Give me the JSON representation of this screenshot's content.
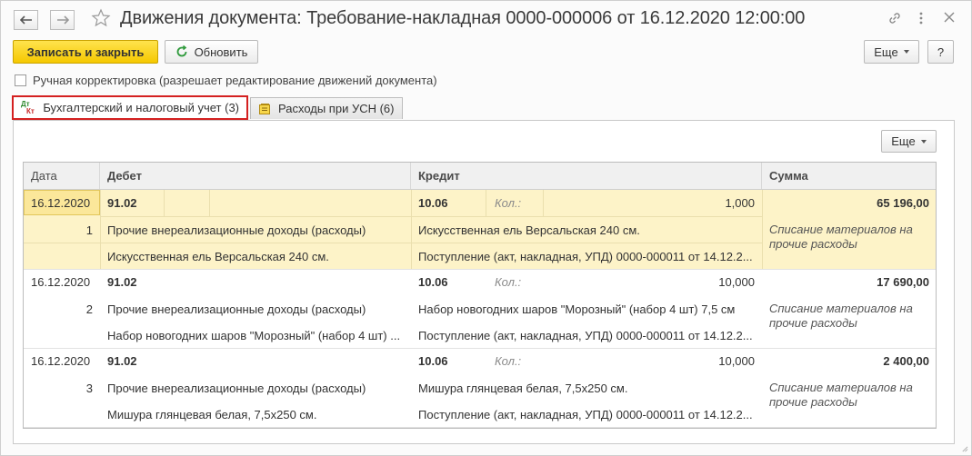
{
  "window": {
    "title": "Движения документа: Требование-накладная 0000-000006 от 16.12.2020 12:00:00",
    "back_icon": "arrow-left-icon",
    "forward_icon": "arrow-right-icon",
    "favorite_icon": "star-icon",
    "link_icon": "link-icon",
    "menu_icon": "more-vertical-icon",
    "close_icon": "close-icon"
  },
  "toolbar": {
    "save_close_label": "Записать и закрыть",
    "refresh_label": "Обновить",
    "more_label": "Еще",
    "help_label": "?"
  },
  "manual_edit": {
    "label": "Ручная корректировка (разрешает редактирование движений документа)",
    "checked": false
  },
  "tabs": [
    {
      "label": "Бухгалтерский и налоговый учет (3)",
      "icon": "dt-kt-icon",
      "icon_top": "Дт",
      "icon_bottom": "Кт",
      "active": true
    },
    {
      "label": "Расходы при УСН (6)",
      "icon": "register-icon",
      "active": false
    }
  ],
  "panel": {
    "more_label": "Еще"
  },
  "table": {
    "columns": [
      "Дата",
      "Дебет",
      "Кредит",
      "Сумма"
    ],
    "rows": [
      {
        "date": "16.12.2020",
        "number": "1",
        "debit_account": "91.02",
        "debit_sub1": "Прочие внереализационные доходы (расходы)",
        "debit_sub2": "Искусственная ель Версальская 240 см.",
        "credit_account": "10.06",
        "qty_label": "Кол.:",
        "qty": "1,000",
        "credit_sub1": "Искусственная ель Версальская 240 см.",
        "credit_sub2": "Поступление (акт, накладная, УПД) 0000-000011 от 14.12.2...",
        "amount": "65 196,00",
        "content": "Списание материалов на прочие расходы",
        "selected": true
      },
      {
        "date": "16.12.2020",
        "number": "2",
        "debit_account": "91.02",
        "debit_sub1": "Прочие внереализационные доходы (расходы)",
        "debit_sub2": "Набор новогодних шаров \"Морозный\" (набор 4 шт) ...",
        "credit_account": "10.06",
        "qty_label": "Кол.:",
        "qty": "10,000",
        "credit_sub1": "Набор новогодних шаров \"Морозный\" (набор 4 шт) 7,5 см",
        "credit_sub2": "Поступление (акт, накладная, УПД) 0000-000011 от 14.12.2...",
        "amount": "17 690,00",
        "content": "Списание материалов на прочие расходы",
        "selected": false
      },
      {
        "date": "16.12.2020",
        "number": "3",
        "debit_account": "91.02",
        "debit_sub1": "Прочие внереализационные доходы (расходы)",
        "debit_sub2": "Мишура глянцевая белая, 7,5х250 см.",
        "credit_account": "10.06",
        "qty_label": "Кол.:",
        "qty": "10,000",
        "credit_sub1": "Мишура глянцевая белая, 7,5х250 см.",
        "credit_sub2": "Поступление (акт, накладная, УПД) 0000-000011 от 14.12.2...",
        "amount": "2 400,00",
        "content": "Списание материалов на прочие расходы",
        "selected": false
      }
    ]
  },
  "colors": {
    "primary_button": "#f5c800",
    "selected_row": "#fdf3c8",
    "active_tab_border": "#d42020"
  }
}
